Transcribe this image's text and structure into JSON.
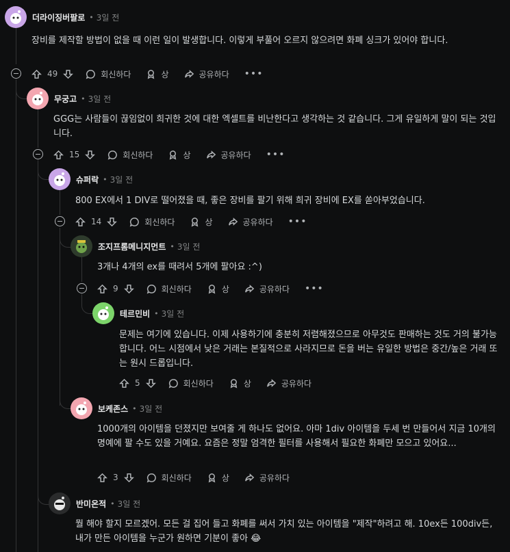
{
  "colors": {
    "background": "#0e0f10",
    "text": "#d7dadc",
    "muted": "#818384",
    "thread": "#343536"
  },
  "comments": [
    {
      "author": "더라이징버팔로",
      "time": "3일 전",
      "avatar_color": "#c9a6e8",
      "body": "장비를 제작할 방법이 없을 때 이런 일이 발생합니다. 이렇게 부풀어 오르지 않으려면 화폐 싱크가 있어야 합니다.",
      "votes": "49",
      "reply": "회신하다",
      "award": "상",
      "share": "공유하다"
    },
    {
      "author": "무궁고",
      "time": "3일 전",
      "avatar_color": "#f3a6b0",
      "body": "GGG는 사람들이 끊임없이 희귀한 것에 대한 엑셀트를 비난한다고 생각하는 것 같습니다. 그게 유일하게 말이 되는 것입니다.",
      "votes": "15",
      "reply": "회신하다",
      "award": "상",
      "share": "공유하다"
    },
    {
      "author": "슈퍼락",
      "time": "3일 전",
      "avatar_color": "#c9a6e8",
      "body": "800 EX에서 1 DIV로 떨어졌을 때, 좋은 장비를 팔기 위해 희귀 장비에 EX를 쏟아부었습니다.",
      "votes": "14",
      "reply": "회신하다",
      "award": "상",
      "share": "공유하다"
    },
    {
      "author": "조지프롬메니지먼트",
      "time": "3일 전",
      "avatar_color": "#2e3b2c",
      "body": "3개나 4개의 ex를 때려서 5개에 팔아요 :^)",
      "votes": "9",
      "reply": "회신하다",
      "award": "상",
      "share": "공유하다"
    },
    {
      "author": "테르민비",
      "time": "3일 전",
      "avatar_color": "#7cd46a",
      "body": "문제는 여기에 있습니다. 이제 사용하기에 충분히 저렴해졌으므로 아무것도 판매하는 것도 거의 불가능합니다. 어느 시점에서 낮은 거래는 본질적으로 사라지므로 돈을 버는 유일한 방법은 중간/높은 거래 또는 원시 드롭입니다.",
      "votes": "5",
      "reply": "회신하다",
      "award": "상",
      "share": "공유하다"
    },
    {
      "author": "보케존스",
      "time": "3일 전",
      "avatar_color": "#f3a6b0",
      "body": "1000개의 아이템을 던졌지만 보여줄 게 하나도 없어요. 아마 1div 아이템을 두세 번 만들어서 지금 10개의 명예에 팔 수도 있을 거예요. 요즘은 정말 엄격한 필터를 사용해서 필요한 화폐만 모으고 있어요...",
      "votes": "3",
      "reply": "회신하다",
      "award": "상",
      "share": "공유하다"
    },
    {
      "author": "반미온적",
      "time": "3일 전",
      "avatar_color": "#2a2b2c",
      "body": "뭘 해야 할지 모르겠어. 모든 걸 집어 들고 화폐를 써서 가치 있는 아이템을 \"제작\"하려고 해. 10ex든 100div든, 내가 만든 아이템을 누군가 원하면 기분이 좋아 😂",
      "votes": "",
      "reply": "",
      "award": "",
      "share": ""
    }
  ],
  "dot": "•",
  "more": "•••"
}
